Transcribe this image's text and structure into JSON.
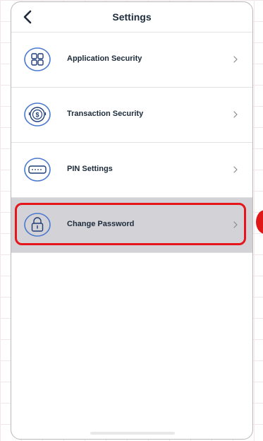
{
  "header": {
    "title": "Settings",
    "back_icon": "chevron-left-icon"
  },
  "menu": {
    "items": [
      {
        "label": "Application Security",
        "icon": "grid-apps-icon",
        "selected": false
      },
      {
        "label": "Transaction Security",
        "icon": "dollar-coin-icon",
        "selected": false
      },
      {
        "label": "PIN Settings",
        "icon": "pin-keypad-icon",
        "selected": false
      },
      {
        "label": "Change Password",
        "icon": "lock-icon",
        "selected": true
      }
    ],
    "chevron_icon": "chevron-right-icon"
  },
  "annotation": {
    "highlight_color": "#e5161b",
    "marker_color": "#e01818"
  },
  "colors": {
    "icon_blue": "#4a78d0",
    "selected_row": "#d3d3d7",
    "text": "#1c2a3a"
  }
}
